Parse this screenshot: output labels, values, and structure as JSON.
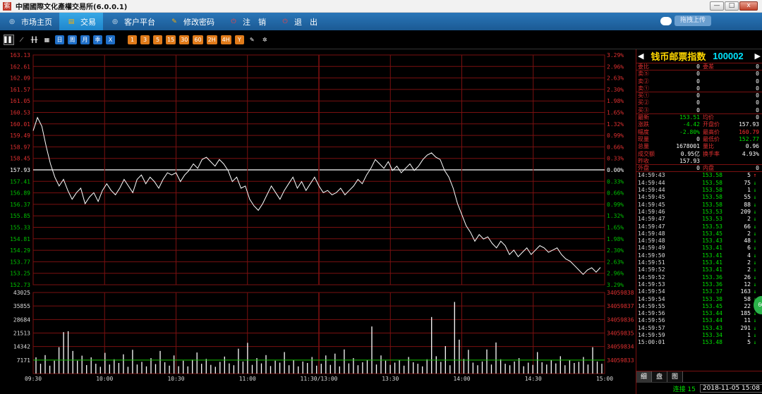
{
  "window": {
    "title": "中國國際文化產權交易所(6.0.0.1)",
    "logo_glyph": "紫",
    "min_glyph": "—",
    "max_glyph": "□",
    "close_glyph": "x"
  },
  "menu": [
    {
      "label": "市场主页",
      "icon": "globe-icon",
      "glyph": "◎",
      "color": "#ffffff",
      "active": false
    },
    {
      "label": "交易",
      "icon": "chart-icon",
      "glyph": "▤",
      "color": "#ffb000",
      "active": true
    },
    {
      "label": "客户平台",
      "icon": "globe-icon",
      "glyph": "◎",
      "color": "#ffffff",
      "active": false
    },
    {
      "label": "修改密码",
      "icon": "pencil-icon",
      "glyph": "✎",
      "color": "#ffb000",
      "active": false
    },
    {
      "label": "注　销",
      "icon": "power-icon",
      "glyph": "⏻",
      "color": "#ff4040",
      "active": false
    },
    {
      "label": "退　出",
      "icon": "power-icon",
      "glyph": "⏻",
      "color": "#ff4040",
      "active": false
    }
  ],
  "upload_label": "拖拽上传",
  "toolbar": {
    "tools": [
      {
        "icon": "bar-chart-icon",
        "glyph": "▌▌",
        "style": "sel"
      },
      {
        "icon": "line-chart-icon",
        "glyph": "⟋",
        "style": "plain"
      },
      {
        "icon": "candlestick-icon",
        "glyph": "╫╫",
        "style": "plain"
      },
      {
        "icon": "calendar-icon",
        "glyph": "▦",
        "style": "plain"
      }
    ],
    "periods": [
      "日",
      "周",
      "月",
      "季",
      "X"
    ],
    "minutes": [
      "1",
      "3",
      "5",
      "15",
      "30",
      "60",
      "2H",
      "4H",
      "Y"
    ],
    "extra": [
      {
        "icon": "draw-icon",
        "glyph": "✎"
      },
      {
        "icon": "gear-icon",
        "glyph": "✲"
      }
    ]
  },
  "instrument": {
    "name": "钱币邮票指数",
    "code": "100002",
    "prev_arrow": "◀",
    "next_arrow": "▶"
  },
  "quote": {
    "weibi": {
      "label": "委比",
      "value": "0",
      "label2": "委差",
      "value2": "0"
    },
    "asks": [
      {
        "label": "卖⑤",
        "value": "0",
        "vol": "0"
      },
      {
        "label": "卖②",
        "value": "0",
        "vol": "0"
      },
      {
        "label": "卖①",
        "value": "0",
        "vol": "0"
      }
    ],
    "bids": [
      {
        "label": "买①",
        "value": "0",
        "vol": "0"
      },
      {
        "label": "买②",
        "value": "0",
        "vol": "0"
      },
      {
        "label": "买③",
        "value": "0",
        "vol": "0"
      }
    ],
    "stats": [
      {
        "l1": "最新",
        "v1": "153.51",
        "c1": "g",
        "l2": "均价",
        "v2": "0",
        "c2": "w"
      },
      {
        "l1": "涨跌",
        "v1": "-4.42",
        "c1": "g",
        "l2": "开盘价",
        "v2": "157.93",
        "c2": "w"
      },
      {
        "l1": "幅度",
        "v1": "-2.80%",
        "c1": "g",
        "l2": "最高价",
        "v2": "160.79",
        "c2": "r"
      },
      {
        "l1": "现量",
        "v1": "0",
        "c1": "w",
        "l2": "最低价",
        "v2": "152.77",
        "c2": "g"
      },
      {
        "l1": "总量",
        "v1": "1678001",
        "c1": "w",
        "l2": "量比",
        "v2": "0.96",
        "c2": "w"
      },
      {
        "l1": "成交额",
        "v1": "0.95亿",
        "c1": "w",
        "l2": "换手率",
        "v2": "4.93%",
        "c2": "w"
      },
      {
        "l1": "昨收",
        "v1": "157.93",
        "c1": "w",
        "l2": "",
        "v2": "",
        "c2": "w"
      }
    ],
    "outer": {
      "l1": "外盘",
      "v1": "0",
      "l2": "内盘",
      "v2": "0"
    }
  },
  "ticks": [
    {
      "t": "14:59:43",
      "p": "153.58",
      "v": "5",
      "d": "↑",
      "c": "r"
    },
    {
      "t": "14:59:44",
      "p": "153.58",
      "v": "75",
      "d": "↓",
      "c": "g"
    },
    {
      "t": "14:59:44",
      "p": "153.58",
      "v": "1",
      "d": "↓",
      "c": "g"
    },
    {
      "t": "14:59:45",
      "p": "153.58",
      "v": "55",
      "d": "↓",
      "c": "g"
    },
    {
      "t": "14:59:45",
      "p": "153.58",
      "v": "88",
      "d": "↓",
      "c": "g"
    },
    {
      "t": "14:59:46",
      "p": "153.53",
      "v": "209",
      "d": "↓",
      "c": "g"
    },
    {
      "t": "14:59:47",
      "p": "153.53",
      "v": "2",
      "d": "↓",
      "c": "g"
    },
    {
      "t": "14:59:47",
      "p": "153.53",
      "v": "66",
      "d": "↓",
      "c": "g"
    },
    {
      "t": "14:59:48",
      "p": "153.45",
      "v": "2",
      "d": "↓",
      "c": "g"
    },
    {
      "t": "14:59:48",
      "p": "153.43",
      "v": "48",
      "d": "↓",
      "c": "g"
    },
    {
      "t": "14:59:49",
      "p": "153.41",
      "v": "6",
      "d": "↓",
      "c": "g"
    },
    {
      "t": "14:59:50",
      "p": "153.41",
      "v": "4",
      "d": "↓",
      "c": "g"
    },
    {
      "t": "14:59:51",
      "p": "153.41",
      "v": "2",
      "d": "↓",
      "c": "g"
    },
    {
      "t": "14:59:52",
      "p": "153.41",
      "v": "2",
      "d": "↓",
      "c": "g"
    },
    {
      "t": "14:59:52",
      "p": "153.36",
      "v": "26",
      "d": "↓",
      "c": "g"
    },
    {
      "t": "14:59:53",
      "p": "153.36",
      "v": "12",
      "d": "↓",
      "c": "g"
    },
    {
      "t": "14:59:54",
      "p": "153.37",
      "v": "163",
      "d": "↓",
      "c": "g"
    },
    {
      "t": "14:59:54",
      "p": "153.38",
      "v": "58",
      "d": "↓",
      "c": "g"
    },
    {
      "t": "14:59:55",
      "p": "153.45",
      "v": "22",
      "d": "↓",
      "c": "g"
    },
    {
      "t": "14:59:56",
      "p": "153.44",
      "v": "185",
      "d": "↓",
      "c": "g"
    },
    {
      "t": "14:59:56",
      "p": "153.44",
      "v": "11",
      "d": "↓",
      "c": "g"
    },
    {
      "t": "14:59:57",
      "p": "153.43",
      "v": "291",
      "d": "↓",
      "c": "g"
    },
    {
      "t": "14:59:59",
      "p": "153.34",
      "v": "1",
      "d": "↓",
      "c": "g"
    },
    {
      "t": "15:00:01",
      "p": "153.48",
      "v": "5",
      "d": "↓",
      "c": "g"
    }
  ],
  "tabs": [
    "细",
    "盘",
    "图"
  ],
  "status": {
    "connection": "连接 15",
    "datetime": "2018-11-05 15:08"
  },
  "float_badge": "60",
  "colors": {
    "grid": "#7a1010",
    "price_line": "#ffffff",
    "volume_bar": "#ffffff",
    "baseline": "#ffffff",
    "up": "#e03030",
    "down": "#00c000",
    "avg_line": "#00c000"
  },
  "chart_data": [
    {
      "type": "line",
      "title": "",
      "series": [
        {
          "name": "",
          "values": [
            159.7,
            160.3,
            159.9,
            159.0,
            158.2,
            157.6,
            157.2,
            157.5,
            157.0,
            156.6,
            156.9,
            157.1,
            156.4,
            156.7,
            156.9,
            156.5,
            157.0,
            157.3,
            157.0,
            156.8,
            157.1,
            157.5,
            157.2,
            156.9,
            157.5,
            157.7,
            157.3,
            157.6,
            157.4,
            157.1,
            157.5,
            157.8,
            157.7,
            157.8,
            157.4,
            157.7,
            157.9,
            158.2,
            158.0,
            158.4,
            158.5,
            158.3,
            158.1,
            158.4,
            158.2,
            157.9,
            157.4,
            157.6,
            157.1,
            157.2,
            156.6,
            156.3,
            156.1,
            156.4,
            156.8,
            157.2,
            156.9,
            156.6,
            157.0,
            157.3,
            157.6,
            157.1,
            157.4,
            157.0,
            157.3,
            157.6,
            157.2,
            156.9,
            157.0,
            156.8,
            156.9,
            157.1,
            156.8,
            157.0,
            157.2,
            157.5,
            157.3,
            157.7,
            158.0,
            158.4,
            158.2,
            158.0,
            158.3,
            157.9,
            158.1,
            157.8,
            158.0,
            158.2,
            157.9,
            158.1,
            158.4,
            158.6,
            158.7,
            158.5,
            158.4,
            157.9,
            157.6,
            157.1,
            156.4,
            155.9,
            155.4,
            155.1,
            154.7,
            155.0,
            154.8,
            154.9,
            154.6,
            154.4,
            154.7,
            154.5,
            154.1,
            154.3,
            154.0,
            154.2,
            154.4,
            154.1,
            154.3,
            154.5,
            154.4,
            154.2,
            154.3,
            154.4,
            154.1,
            153.9,
            153.8,
            153.6,
            153.4,
            153.2,
            153.4,
            153.5,
            153.3,
            153.51
          ]
        }
      ],
      "categories_labels": [
        "09:30",
        "10:00",
        "10:30",
        "11:00",
        "11:30/13:00",
        "13:30",
        "14:00",
        "14:30",
        "15:00"
      ],
      "y_ticks_left": [
        "163.13",
        "162.61",
        "162.09",
        "161.57",
        "161.05",
        "160.53",
        "160.01",
        "159.49",
        "158.97",
        "158.45",
        "157.93",
        "157.41",
        "156.89",
        "156.37",
        "155.85",
        "155.33",
        "154.81",
        "154.29",
        "153.77",
        "153.25",
        "152.73"
      ],
      "y_ticks_right": [
        "3.29%",
        "2.96%",
        "2.63%",
        "2.30%",
        "1.98%",
        "1.65%",
        "1.32%",
        "0.99%",
        "0.66%",
        "0.33%",
        "0.00%",
        "0.33%",
        "0.66%",
        "0.99%",
        "1.32%",
        "1.65%",
        "1.98%",
        "2.30%",
        "2.63%",
        "2.96%",
        "3.29%"
      ],
      "ylim": [
        152.73,
        163.13
      ],
      "reference_value": 157.93,
      "grid": true
    },
    {
      "type": "bar",
      "title": "",
      "series": [
        {
          "name": "",
          "values": [
            8600,
            5200,
            9800,
            4200,
            6800,
            14000,
            22000,
            22500,
            12000,
            6800,
            9500,
            4500,
            8600,
            5200,
            3600,
            11000,
            4800,
            7600,
            5600,
            10200,
            3600,
            12600,
            4800,
            6200,
            3800,
            8200,
            5000,
            12000,
            6000,
            4200,
            9600,
            3900,
            6800,
            3800,
            7400,
            11200,
            5200,
            7800,
            4600,
            3600,
            6200,
            9000,
            5400,
            4400,
            13200,
            6400,
            16300,
            4600,
            8200,
            5400,
            9800,
            4000,
            6800,
            5800,
            11400,
            4400,
            7200,
            3800,
            6400,
            5600,
            8800,
            4200,
            5200,
            9600,
            4600,
            10600,
            3800,
            12800,
            5400,
            8200,
            4400,
            6000,
            7200,
            25000,
            4800,
            9600,
            6800,
            4600,
            5800,
            7200,
            4200,
            8800,
            6000,
            5200,
            3800,
            7600,
            30000,
            9200,
            6200,
            14600,
            4400,
            38000,
            18000,
            7800,
            12600,
            5800,
            4400,
            6400,
            12800,
            4800,
            16500,
            7600,
            5200,
            4400,
            6400,
            8200,
            3900,
            5800,
            4600,
            11400,
            6000,
            4800,
            7200,
            5400,
            9200,
            4400,
            7000,
            5600,
            6200,
            8800,
            4800,
            14000,
            6400,
            5200
          ]
        }
      ],
      "categories_labels": [
        "09:30",
        "10:00",
        "10:30",
        "11:00",
        "11:30/13:00",
        "13:30",
        "14:00",
        "14:30",
        "15:00"
      ],
      "y_ticks_left": [
        "43025",
        "35855",
        "28684",
        "21513",
        "14342",
        "7171"
      ],
      "y_ticks_right": [
        "34059838",
        "34059837",
        "34059836",
        "34059835",
        "34059834",
        "34059833"
      ],
      "ylim": [
        0,
        43025
      ],
      "reference_value": 7171,
      "grid": true
    }
  ]
}
